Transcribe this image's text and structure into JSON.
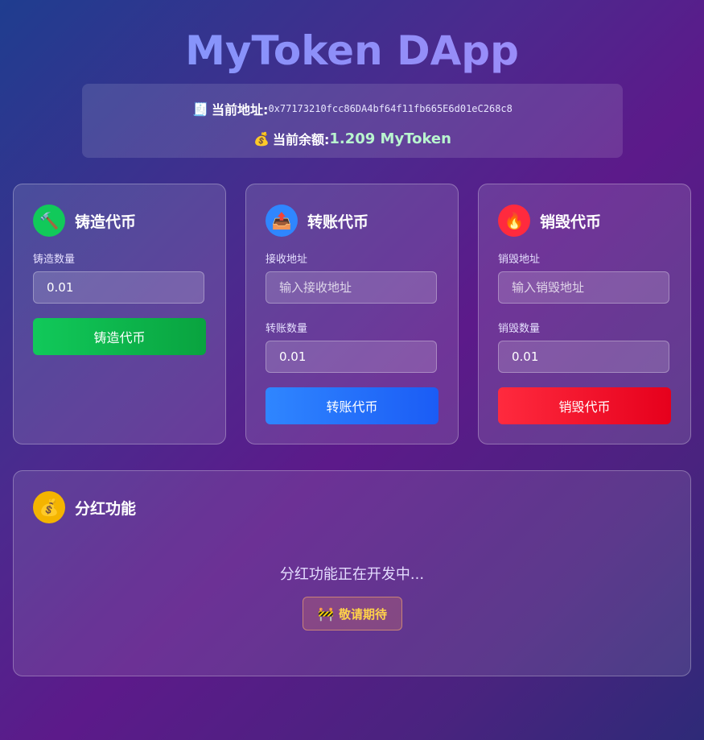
{
  "app": {
    "title": "MyToken DApp"
  },
  "account": {
    "address_icon": "receipt-icon",
    "address_label": "当前地址:",
    "address_value": "0x77173210fcc86DA4bf64f11fb665E6d01eC268c8",
    "balance_icon": "money-bag-icon",
    "balance_label": "当前余额:",
    "balance_value": "1.209 MyToken"
  },
  "mint": {
    "icon": "hammer-icon",
    "title": "铸造代币",
    "amount_label": "铸造数量",
    "amount_value": "0.01",
    "button_label": "铸造代币",
    "accent": "#11c95a"
  },
  "transfer": {
    "icon": "outbox-tray-icon",
    "title": "转账代币",
    "address_label": "接收地址",
    "address_placeholder": "输入接收地址",
    "amount_label": "转账数量",
    "amount_value": "0.01",
    "button_label": "转账代币",
    "accent": "#2f86ff"
  },
  "burn": {
    "icon": "fire-icon",
    "title": "销毁代币",
    "address_label": "销毁地址",
    "address_placeholder": "输入销毁地址",
    "amount_label": "销毁数量",
    "amount_value": "0.01",
    "button_label": "销毁代币",
    "accent": "#ff2a3e"
  },
  "dividend": {
    "icon": "money-bag-icon",
    "title": "分红功能",
    "status_text": "分红功能正在开发中...",
    "coming_icon": "construction-icon",
    "coming_label": "敬请期待",
    "accent": "#f4b400"
  }
}
